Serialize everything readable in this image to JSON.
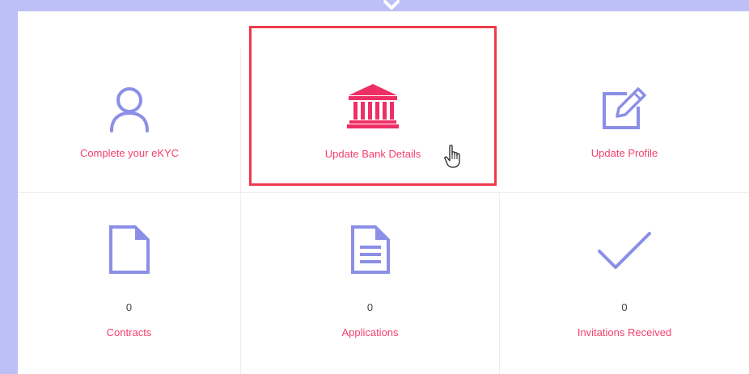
{
  "tiles": {
    "ekyc": {
      "label": "Complete your eKYC",
      "icon": "user-icon"
    },
    "bank": {
      "label": "Update Bank Details",
      "icon": "bank-icon"
    },
    "profile": {
      "label": "Update Profile",
      "icon": "edit-icon"
    },
    "contracts": {
      "label": "Contracts",
      "count": "0",
      "icon": "file-icon"
    },
    "applications": {
      "label": "Applications",
      "count": "0",
      "icon": "document-icon"
    },
    "invitations": {
      "label": "Invitations Received",
      "count": "0",
      "icon": "check-icon"
    }
  },
  "colors": {
    "accent_text": "#f5406e",
    "icon_purple": "#8b8fe6",
    "bank_icon": "#ee2f66",
    "highlight_border": "#ee3b4c",
    "background": "#bdc0f6"
  }
}
